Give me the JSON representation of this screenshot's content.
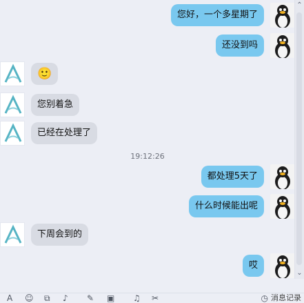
{
  "messages": [
    {
      "side": "right",
      "text": "您好，一个多星期了"
    },
    {
      "side": "right",
      "text": "还没到吗"
    },
    {
      "side": "left",
      "text": "🙂"
    },
    {
      "side": "left",
      "text": "您别着急"
    },
    {
      "side": "left",
      "text": "已经在处理了"
    },
    {
      "side": "right",
      "text": "都处理5天了"
    },
    {
      "side": "right",
      "text": "什么时候能出呢"
    },
    {
      "side": "left",
      "text": "下周会到的"
    },
    {
      "side": "right",
      "text": "哎"
    }
  ],
  "timestamp": "19:12:26",
  "toolbar": {
    "icons": [
      "font-icon",
      "emoji-icon",
      "vibrate-icon",
      "voice-icon",
      "screenshot-icon",
      "image-icon",
      "music-icon",
      "scissors-icon"
    ],
    "history_label": "消息记录"
  },
  "colors": {
    "outgoing_bubble": "#79c8ef",
    "incoming_bubble": "#d8dbe3",
    "background": "#eceef5"
  }
}
